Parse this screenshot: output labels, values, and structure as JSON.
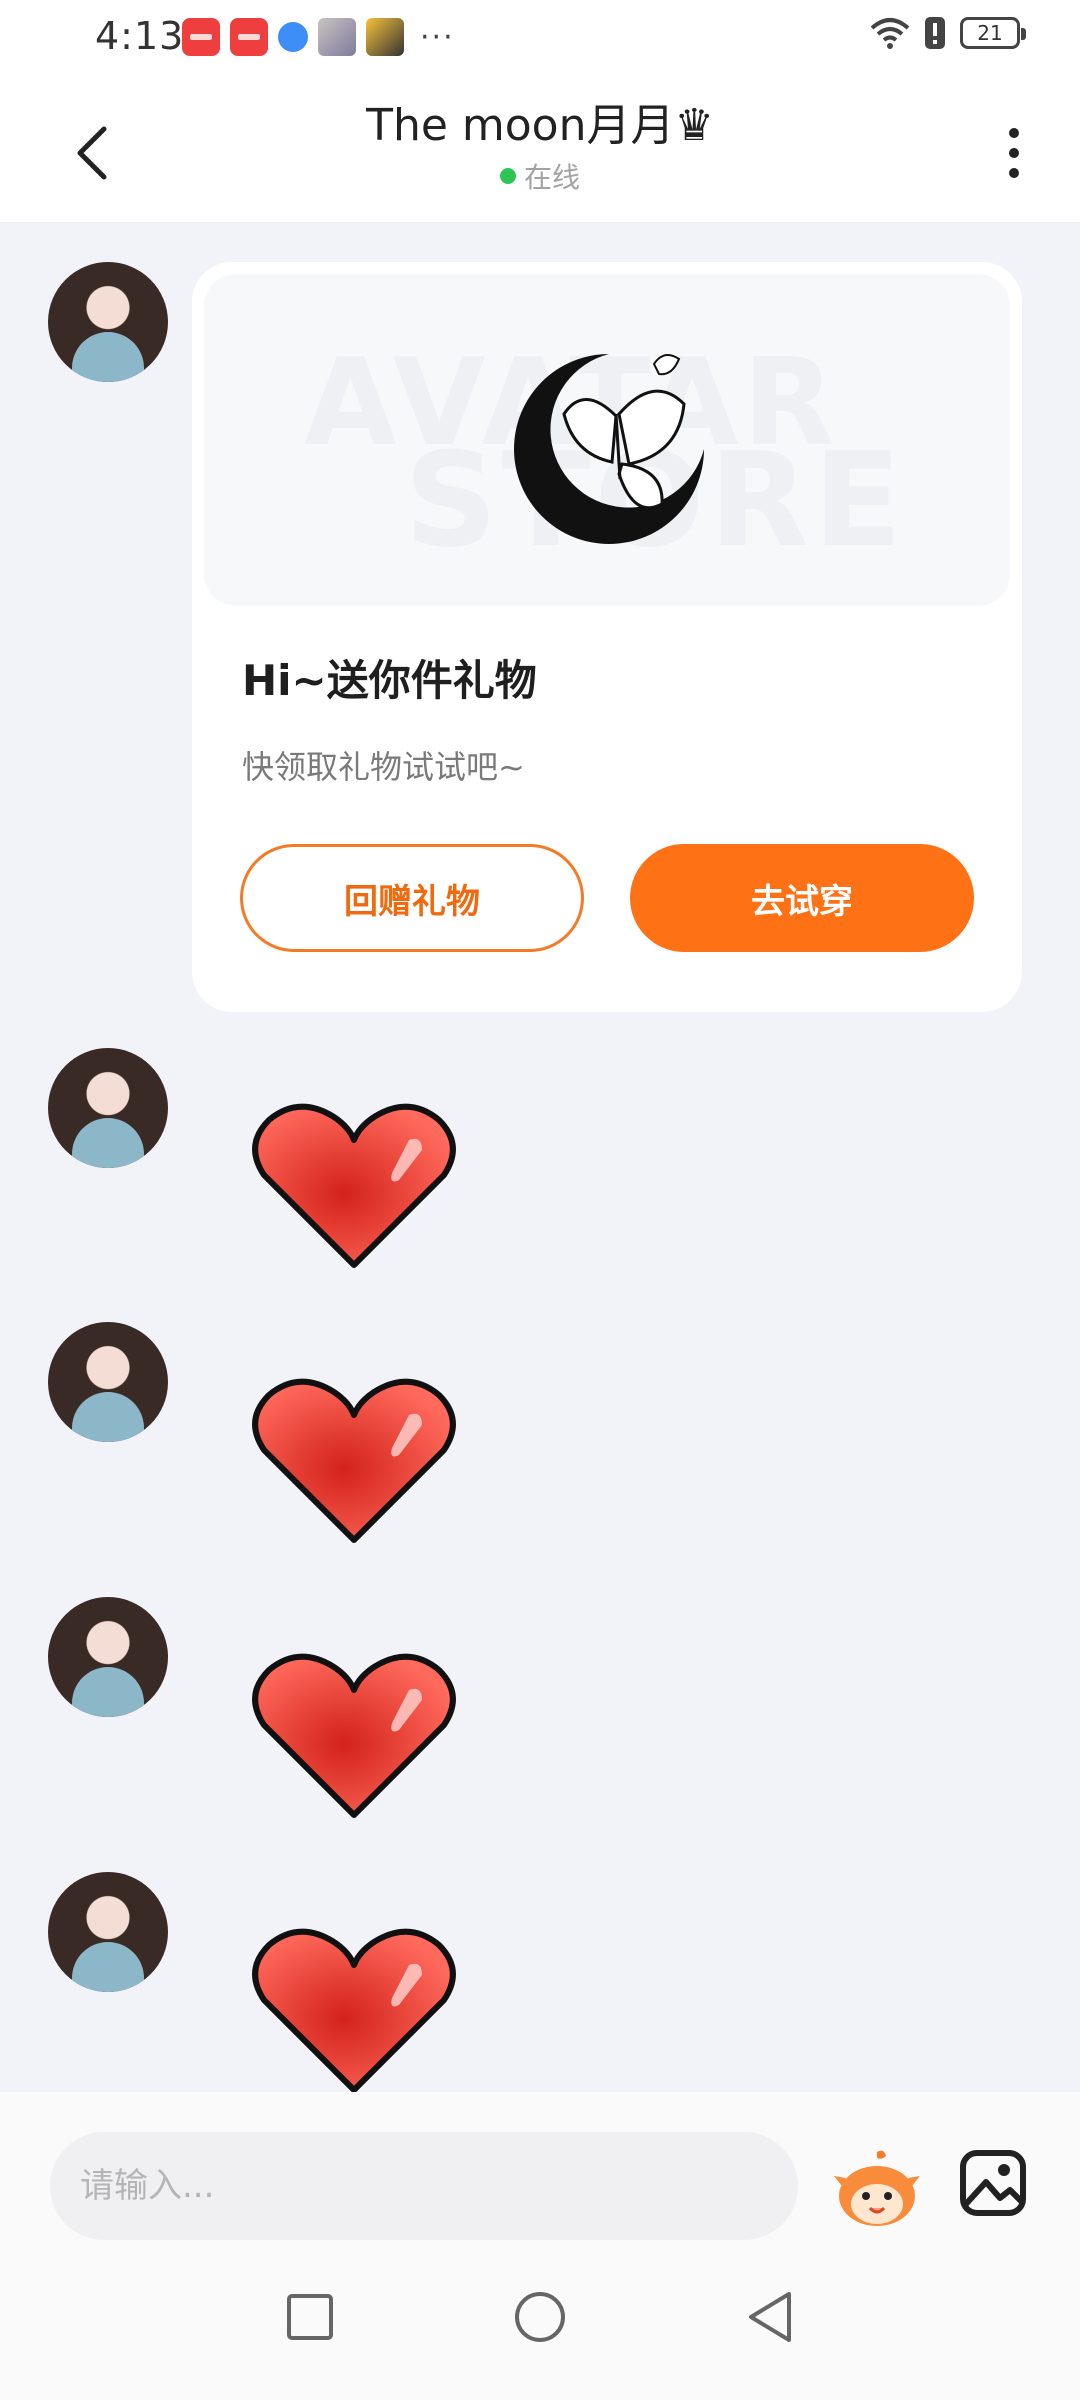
{
  "status_bar": {
    "time": "4:13",
    "more_indicator": "···",
    "battery_level": "21"
  },
  "header": {
    "title": "The moon月月♛",
    "status": "在线"
  },
  "gift_card": {
    "title": "Hi~送你件礼物",
    "subtitle": "快领取礼物试试吧~",
    "watermark_line1": "AVATAR",
    "watermark_line2": "STORE",
    "return_gift_label": "回赠礼物",
    "try_on_label": "去试穿"
  },
  "messages": [
    {
      "type": "gift"
    },
    {
      "type": "sticker",
      "icon": "heart-sticker"
    },
    {
      "type": "sticker",
      "icon": "heart-sticker"
    },
    {
      "type": "sticker",
      "icon": "heart-sticker"
    },
    {
      "type": "sticker",
      "icon": "heart-sticker"
    }
  ],
  "composer": {
    "placeholder": "请输入..."
  },
  "colors": {
    "accent": "#fe7114",
    "online": "#2fc456",
    "background": "#f1f3f9"
  }
}
